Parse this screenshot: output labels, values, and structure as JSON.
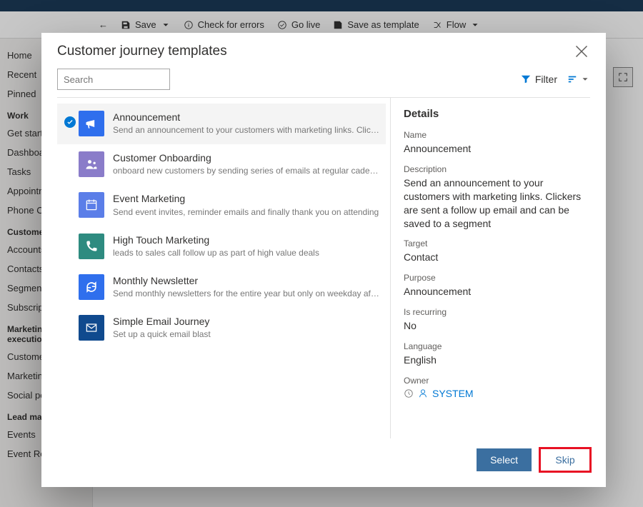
{
  "bg": {
    "cmdbar": {
      "back": "←",
      "save": "Save",
      "check": "Check for errors",
      "golive": "Go live",
      "saveas": "Save as template",
      "flow": "Flow"
    },
    "nav": {
      "items_top": [
        "Home",
        "Recent",
        "Pinned"
      ],
      "grp1": "Work",
      "items1": [
        "Get started",
        "Dashboards",
        "Tasks",
        "Appointments",
        "Phone Calls"
      ],
      "grp2": "Customers",
      "items2": [
        "Accounts",
        "Contacts",
        "Segments",
        "Subscriptions"
      ],
      "grp3": "Marketing execution",
      "items3": [
        "Customer journeys",
        "Marketing emails",
        "Social posts"
      ],
      "grp4": "Lead management",
      "items4": [
        "Events",
        "Event Registrations"
      ]
    },
    "right_label": "Is recurring"
  },
  "modal": {
    "title": "Customer journey templates",
    "search_placeholder": "Search",
    "filter_label": "Filter",
    "select_label": "Select",
    "skip_label": "Skip"
  },
  "templates": [
    {
      "name": "Announcement",
      "desc": "Send an announcement to your customers with marketing links. Clickers are sent a…",
      "color": "#2f6fed"
    },
    {
      "name": "Customer Onboarding",
      "desc": "onboard new customers by sending series of emails at regular cadence",
      "color": "#8a7cc9"
    },
    {
      "name": "Event Marketing",
      "desc": "Send event invites, reminder emails and finally thank you on attending",
      "color": "#5b7ee8"
    },
    {
      "name": "High Touch Marketing",
      "desc": "leads to sales call follow up as part of high value deals",
      "color": "#2e8b80"
    },
    {
      "name": "Monthly Newsletter",
      "desc": "Send monthly newsletters for the entire year but only on weekday afternoons",
      "color": "#2f6fed"
    },
    {
      "name": "Simple Email Journey",
      "desc": "Set up a quick email blast",
      "color": "#104a8e"
    }
  ],
  "details": {
    "heading": "Details",
    "labels": {
      "name": "Name",
      "description": "Description",
      "target": "Target",
      "purpose": "Purpose",
      "recurring": "Is recurring",
      "language": "Language",
      "owner": "Owner"
    },
    "name": "Announcement",
    "description": "Send an announcement to your customers with marketing links. Clickers are sent a follow up email and can be saved to a segment",
    "target": "Contact",
    "purpose": "Announcement",
    "recurring": "No",
    "language": "English",
    "owner": "SYSTEM"
  }
}
